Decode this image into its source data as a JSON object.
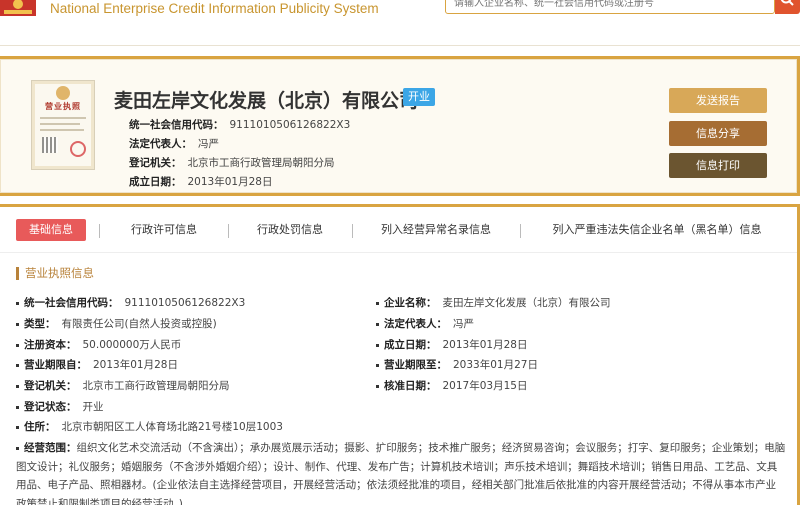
{
  "header": {
    "site_title": "National Enterprise Credit Information Publicity System",
    "search_placeholder": "请输入企业名称、统一社会信用代码或注册号"
  },
  "company": {
    "name": "麦田左岸文化发展（北京）有限公司",
    "status": "开业",
    "license_title": "营业执照",
    "credit_code_label": "统一社会信用代码：",
    "credit_code": "9111010506126822X3",
    "legal_rep_label": "法定代表人：",
    "legal_rep": "冯严",
    "registry_label": "登记机关：",
    "registry": "北京市工商行政管理局朝阳分局",
    "established_label": "成立日期：",
    "established": "2013年01月28日"
  },
  "actions": {
    "report": "发送报告",
    "share": "信息分享",
    "print": "信息打印"
  },
  "tabs": [
    {
      "label": "基础信息",
      "active": true
    },
    {
      "label": "行政许可信息",
      "active": false
    },
    {
      "label": "行政处罚信息",
      "active": false
    },
    {
      "label": "列入经营异常名录信息",
      "active": false
    },
    {
      "label": "列入严重违法失信企业名单（黑名单）信息",
      "active": false
    }
  ],
  "section": {
    "title": "营业执照信息",
    "fields": [
      {
        "label": "统一社会信用代码：",
        "value": "9111010506126822X3"
      },
      {
        "label": "企业名称：",
        "value": "麦田左岸文化发展（北京）有限公司"
      },
      {
        "label": "类型：",
        "value": "有限责任公司(自然人投资或控股)"
      },
      {
        "label": "法定代表人：",
        "value": "冯严"
      },
      {
        "label": "注册资本：",
        "value": "50.000000万人民币"
      },
      {
        "label": "成立日期：",
        "value": "2013年01月28日"
      },
      {
        "label": "营业期限自：",
        "value": "2013年01月28日"
      },
      {
        "label": "营业期限至：",
        "value": "2033年01月27日"
      },
      {
        "label": "登记机关：",
        "value": "北京市工商行政管理局朝阳分局"
      },
      {
        "label": "核准日期：",
        "value": "2017年03月15日"
      },
      {
        "label": "登记状态：",
        "value": "开业"
      },
      {
        "label": "住所：",
        "value": "北京市朝阳区工人体育场北路21号楼10层1003"
      }
    ],
    "scope_label": "经营范围：",
    "scope": "组织文化艺术交流活动（不含演出）；承办展览展示活动；摄影、扩印服务；技术推广服务；经济贸易咨询；会议服务；打字、复印服务；企业策划；电脑图文设计；礼仪服务；婚姻服务（不含涉外婚姻介绍）；设计、制作、代理、发布广告；计算机技术培训；声乐技术培训；舞蹈技术培训；销售日用品、工艺品、文具用品、电子产品、照相器材。(企业依法自主选择经营项目，开展经营活动；依法须经批准的项目，经相关部门批准后依批准的内容开展经营活动；不得从事本市产业政策禁止和限制类项目的经营活动。)"
  },
  "colors": {
    "gold": "#d9a441",
    "title_gold": "#c8952f",
    "active_tab": "#e85a5a",
    "status_blue": "#3ca6e6"
  }
}
